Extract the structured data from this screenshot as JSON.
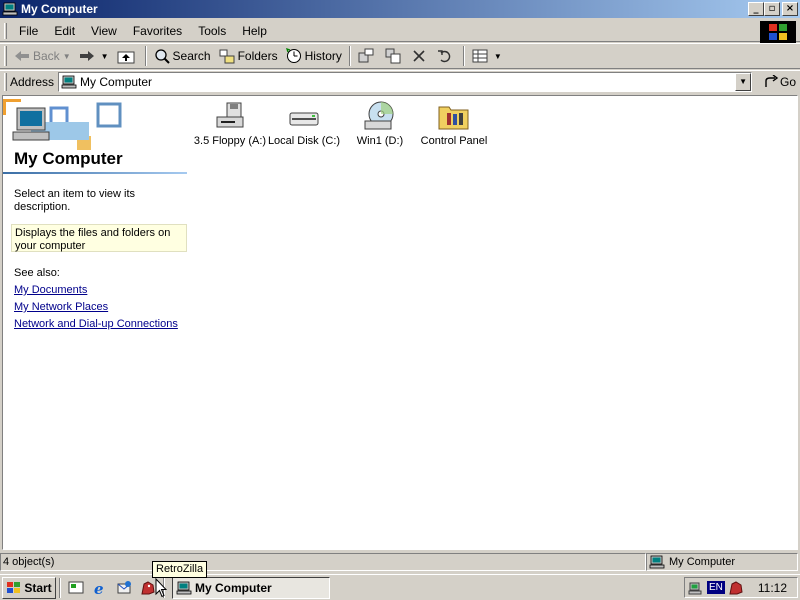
{
  "window": {
    "title": "My Computer",
    "controls": {
      "minimize": "_",
      "maximize": "▫",
      "close": "×"
    }
  },
  "menu": [
    "File",
    "Edit",
    "View",
    "Favorites",
    "Tools",
    "Help"
  ],
  "toolbar": {
    "back": "Back",
    "search": "Search",
    "folders": "Folders",
    "history": "History"
  },
  "address": {
    "label": "Address",
    "value": "My Computer",
    "go": "Go"
  },
  "left_pane": {
    "title": "My Computer",
    "hint": "Select an item to view its description.",
    "description": "Displays the files and folders on your computer",
    "see_also": "See also:",
    "links": [
      "My Documents",
      "My Network Places",
      "Network and Dial-up Connections"
    ]
  },
  "items": [
    {
      "label": "3.5 Floppy (A:)",
      "icon": "floppy-drive-icon"
    },
    {
      "label": "Local Disk (C:)",
      "icon": "hard-disk-icon"
    },
    {
      "label": "Win1 (D:)",
      "icon": "cd-drive-icon"
    },
    {
      "label": "Control Panel",
      "icon": "control-panel-folder-icon"
    }
  ],
  "status": {
    "count": "4 object(s)",
    "zone": "My Computer"
  },
  "taskbar": {
    "start": "Start",
    "task": "My Computer",
    "tooltip": "RetroZilla",
    "lang": "EN",
    "clock": "11:12"
  },
  "colors": {
    "title_start": "#0a246a",
    "title_end": "#a6caf0",
    "face": "#d4d0c8",
    "link": "#00008b",
    "tooltip_bg": "#ffffe1"
  }
}
